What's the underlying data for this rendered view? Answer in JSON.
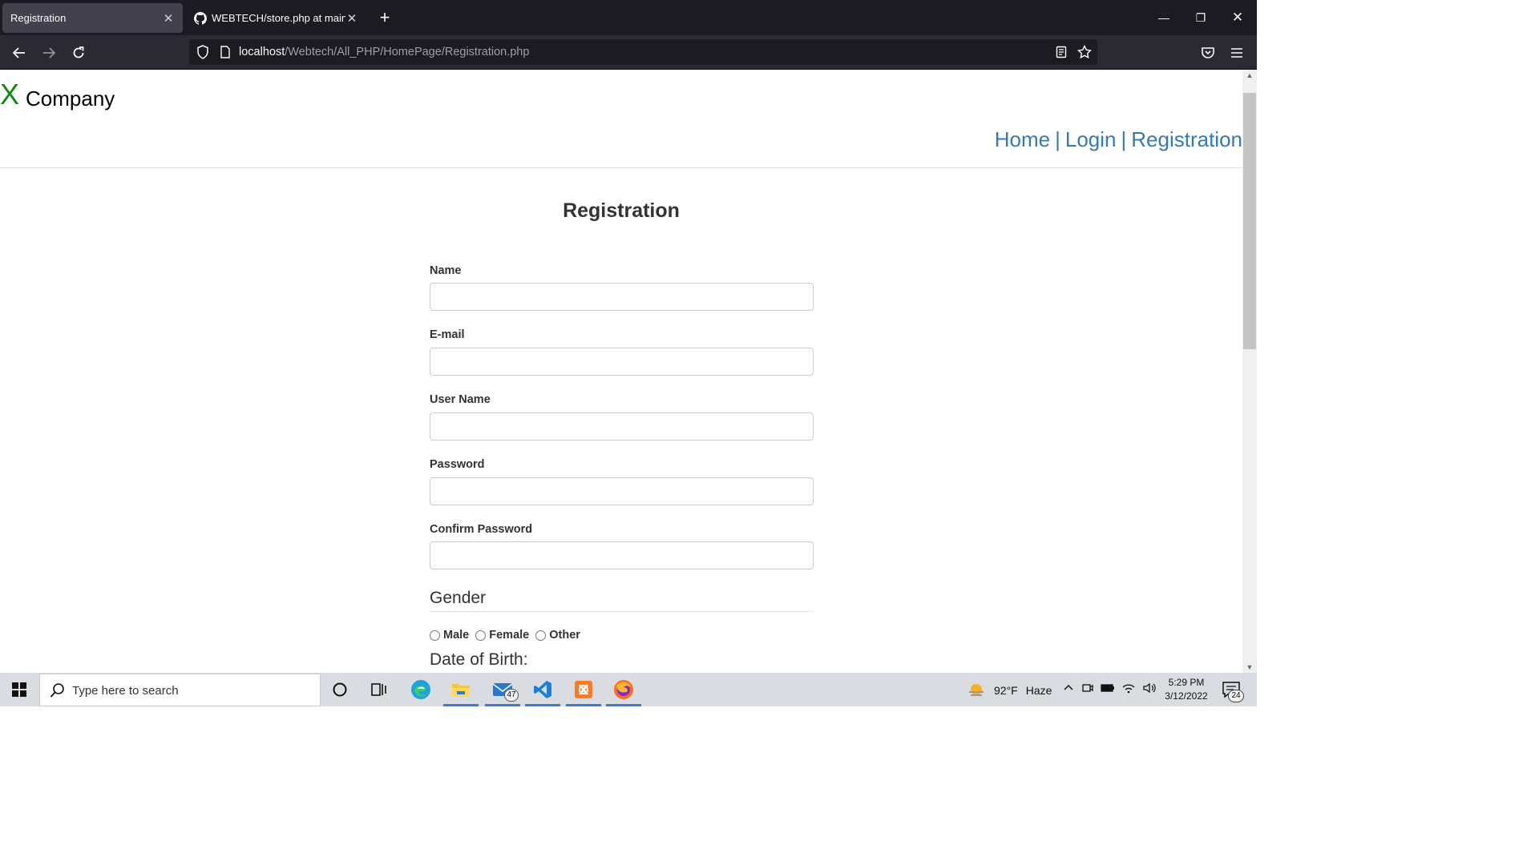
{
  "browser": {
    "tabs": [
      {
        "title": "Registration",
        "active": true
      },
      {
        "title": "WEBTECH/store.php at main · S",
        "active": false
      }
    ],
    "url": {
      "host": "localhost",
      "path": "/Webtech/All_PHP/HomePage/Registration.php"
    }
  },
  "page": {
    "logo": {
      "mark": "X",
      "name": "Company"
    },
    "nav": {
      "home": "Home",
      "login": "Login",
      "registration": "Registration",
      "separator": "|"
    },
    "form": {
      "title": "Registration",
      "fields": {
        "name": {
          "label": "Name",
          "value": ""
        },
        "email": {
          "label": "E-mail",
          "value": ""
        },
        "username": {
          "label": "User Name",
          "value": ""
        },
        "password": {
          "label": "Password",
          "value": ""
        },
        "confirm_password": {
          "label": "Confirm Password",
          "value": ""
        }
      },
      "gender": {
        "legend": "Gender",
        "options": [
          "Male",
          "Female",
          "Other"
        ]
      },
      "dob": {
        "legend": "Date of Birth:"
      }
    }
  },
  "taskbar": {
    "search_placeholder": "Type here to search",
    "mail_badge": "47",
    "weather": {
      "temp": "92°F",
      "condition": "Haze"
    },
    "clock": {
      "time": "5:29 PM",
      "date": "3/12/2022"
    },
    "notifications": "24"
  },
  "colors": {
    "link": "#337ab7",
    "logo_mark": "#0e8a0e",
    "chrome_dark": "#1c1b22",
    "taskbar_bg": "#d9dce0"
  }
}
